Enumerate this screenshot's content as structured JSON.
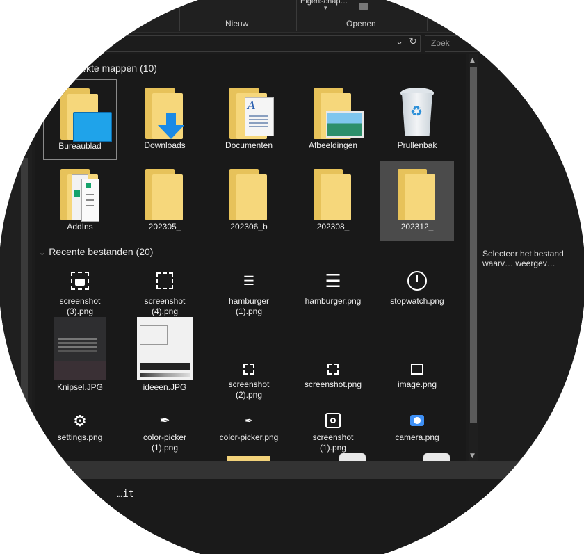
{
  "ribbon": {
    "nieuw_label": "Nieuw",
    "openen_label": "Openen",
    "properties_label": "Eigenschap…"
  },
  "search": {
    "placeholder": "Zoek"
  },
  "frequent": {
    "header": "…kte mappen (10)",
    "items": [
      {
        "label": "Bureaublad",
        "icon": "desktop-folder-icon"
      },
      {
        "label": "Downloads",
        "icon": "downloads-folder-icon"
      },
      {
        "label": "Documenten",
        "icon": "documents-folder-icon"
      },
      {
        "label": "Afbeeldingen",
        "icon": "pictures-folder-icon"
      },
      {
        "label": "Prullenbak",
        "icon": "recycle-bin-icon"
      },
      {
        "label": "AddIns",
        "icon": "addins-folder-icon"
      },
      {
        "label": "202305_",
        "icon": "folder-icon"
      },
      {
        "label": "202306_b",
        "icon": "folder-icon"
      },
      {
        "label": "202308_",
        "icon": "folder-icon"
      },
      {
        "label": "202312_",
        "icon": "folder-icon"
      }
    ]
  },
  "recent": {
    "header": "Recente bestanden (20)",
    "items": [
      {
        "label": "screenshot\n(3).png",
        "icon": "screenshot-icon"
      },
      {
        "label": "screenshot\n(4).png",
        "icon": "screenshot-icon"
      },
      {
        "label": "hamburger\n(1).png",
        "icon": "hamburger-icon"
      },
      {
        "label": "hamburger.png",
        "icon": "hamburger-icon"
      },
      {
        "label": "stopwatch.png",
        "icon": "stopwatch-icon"
      },
      {
        "label": "Knipsel.JPG",
        "icon": "image-thumbnail"
      },
      {
        "label": "ideeen.JPG",
        "icon": "image-thumbnail"
      },
      {
        "label": "screenshot\n(2).png",
        "icon": "screenshot-icon"
      },
      {
        "label": "screenshot.png",
        "icon": "screenshot-icon"
      },
      {
        "label": "image.png",
        "icon": "image-icon"
      },
      {
        "label": "settings.png",
        "icon": "gear-icon"
      },
      {
        "label": "color-picker\n(1).png",
        "icon": "eyedropper-icon"
      },
      {
        "label": "color-picker.png",
        "icon": "eyedropper-icon"
      },
      {
        "label": "screenshot\n(1).png",
        "icon": "screenshot-icon"
      },
      {
        "label": "camera.png",
        "icon": "camera-icon"
      }
    ]
  },
  "preview": {
    "text": "Selecteer het bestand waarv… weergev…"
  },
  "terminal": {
    "line": "…it"
  }
}
